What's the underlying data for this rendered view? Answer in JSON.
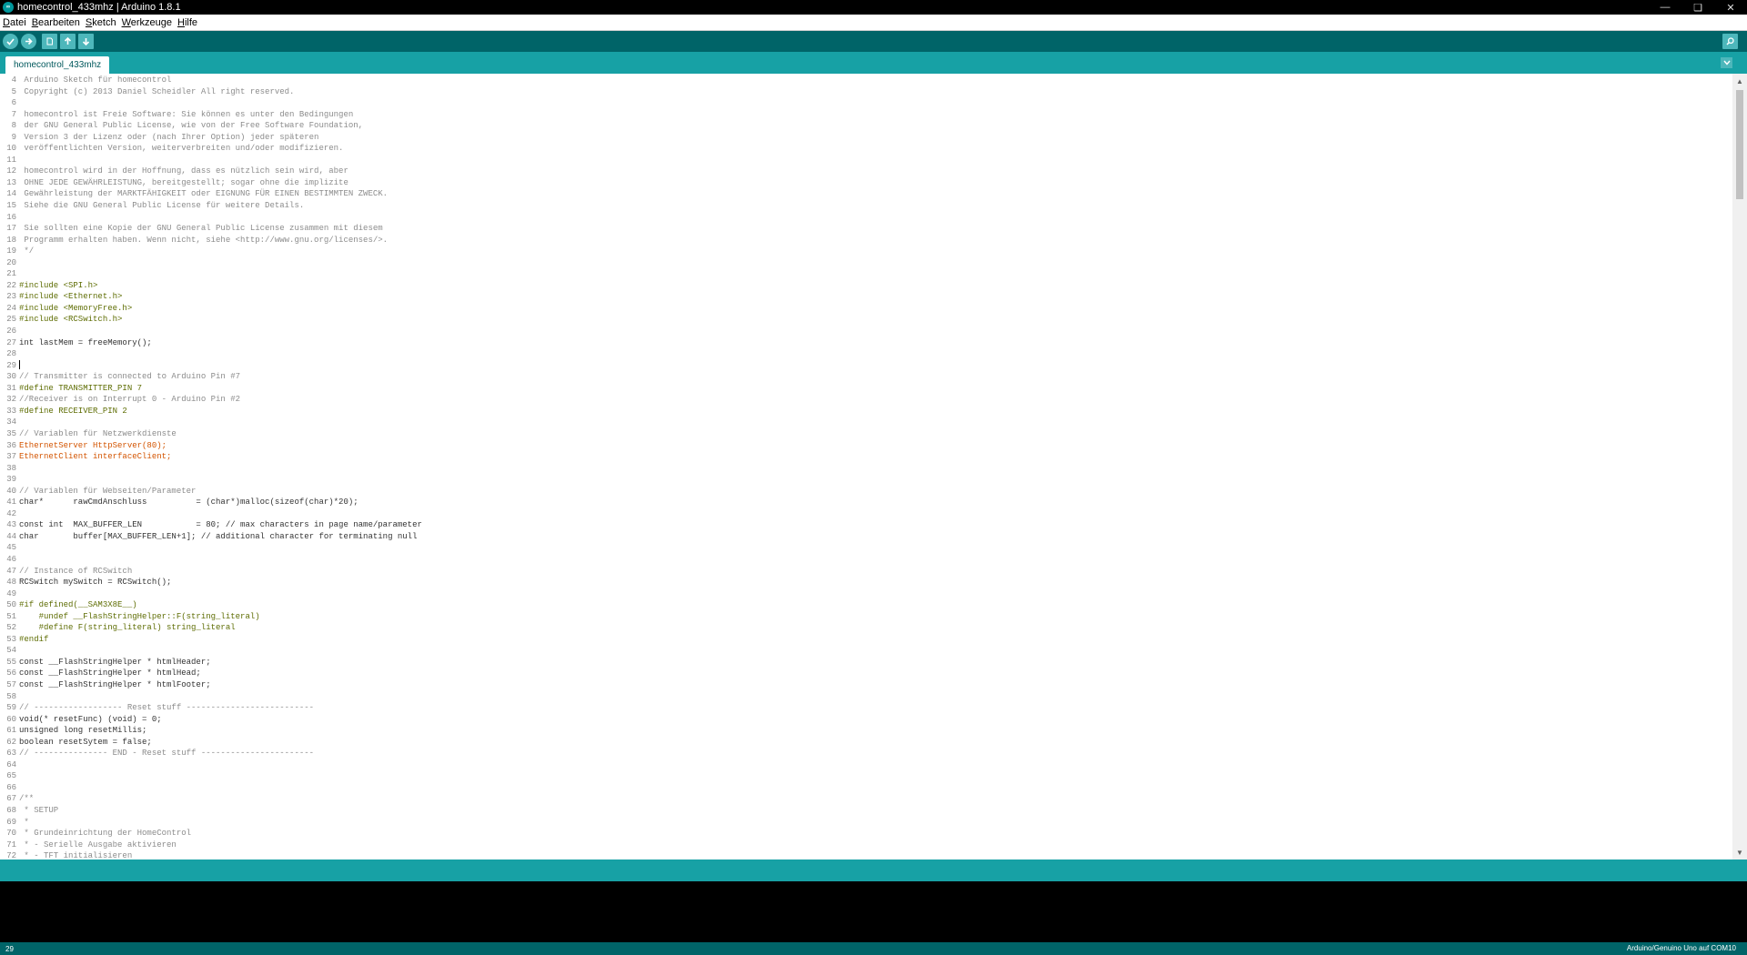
{
  "window": {
    "title": "homecontrol_433mhz | Arduino 1.8.1",
    "controls": [
      "minimize-icon",
      "restore-icon",
      "close-icon"
    ]
  },
  "menu": [
    {
      "label": "Datei",
      "underline": "D",
      "rest": "atei"
    },
    {
      "label": "Bearbeiten",
      "underline": "B",
      "rest": "earbeiten"
    },
    {
      "label": "Sketch",
      "underline": "S",
      "rest": "ketch"
    },
    {
      "label": "Werkzeuge",
      "underline": "W",
      "rest": "erkzeuge"
    },
    {
      "label": "Hilfe",
      "underline": "H",
      "rest": "ilfe"
    }
  ],
  "toolbar": {
    "buttons": [
      "verify",
      "upload",
      "new",
      "open",
      "save"
    ],
    "serial_monitor": "serial-monitor"
  },
  "tabs": [
    {
      "label": "homecontrol_433mhz"
    }
  ],
  "editor": {
    "lines": [
      {
        "n": "4",
        "text": " Arduino Sketch für homecontrol",
        "cls": "comment"
      },
      {
        "n": "5",
        "text": " Copyright (c) 2013 Daniel Scheidler All right reserved.",
        "cls": "comment"
      },
      {
        "n": "6",
        "text": "",
        "cls": "comment"
      },
      {
        "n": "7",
        "text": " homecontrol ist Freie Software: Sie können es unter den Bedingungen",
        "cls": "comment"
      },
      {
        "n": "8",
        "text": " der GNU General Public License, wie von der Free Software Foundation,",
        "cls": "comment"
      },
      {
        "n": "9",
        "text": " Version 3 der Lizenz oder (nach Ihrer Option) jeder späteren",
        "cls": "comment"
      },
      {
        "n": "10",
        "text": " veröffentlichten Version, weiterverbreiten und/oder modifizieren.",
        "cls": "comment"
      },
      {
        "n": "11",
        "text": "",
        "cls": "comment"
      },
      {
        "n": "12",
        "text": " homecontrol wird in der Hoffnung, dass es nützlich sein wird, aber",
        "cls": "comment"
      },
      {
        "n": "13",
        "text": " OHNE JEDE GEWÄHRLEISTUNG, bereitgestellt; sogar ohne die implizite",
        "cls": "comment"
      },
      {
        "n": "14",
        "text": " Gewährleistung der MARKTFÄHIGKEIT oder EIGNUNG FÜR EINEN BESTIMMTEN ZWECK.",
        "cls": "comment"
      },
      {
        "n": "15",
        "text": " Siehe die GNU General Public License für weitere Details.",
        "cls": "comment"
      },
      {
        "n": "16",
        "text": "",
        "cls": "comment"
      },
      {
        "n": "17",
        "text": " Sie sollten eine Kopie der GNU General Public License zusammen mit diesem",
        "cls": "comment"
      },
      {
        "n": "18",
        "text": " Programm erhalten haben. Wenn nicht, siehe <http://www.gnu.org/licenses/>.",
        "cls": "comment"
      },
      {
        "n": "19",
        "text": " */",
        "cls": "comment"
      },
      {
        "n": "20",
        "text": "",
        "cls": ""
      },
      {
        "n": "21",
        "text": "",
        "cls": ""
      },
      {
        "n": "22",
        "text": "#include <SPI.h>",
        "cls": "pp"
      },
      {
        "n": "23",
        "text": "#include <Ethernet.h>",
        "cls": "pp"
      },
      {
        "n": "24",
        "text": "#include <MemoryFree.h>",
        "cls": "pp"
      },
      {
        "n": "25",
        "text": "#include <RCSwitch.h>",
        "cls": "pp"
      },
      {
        "n": "26",
        "text": "",
        "cls": ""
      },
      {
        "n": "27",
        "text": "int lastMem = freeMemory();",
        "cls": ""
      },
      {
        "n": "28",
        "text": "",
        "cls": ""
      },
      {
        "n": "29",
        "text": "",
        "cls": "",
        "caret": true
      },
      {
        "n": "30",
        "text": "// Transmitter is connected to Arduino Pin #7",
        "cls": "comment"
      },
      {
        "n": "31",
        "text": "#define TRANSMITTER_PIN 7",
        "cls": "pp"
      },
      {
        "n": "32",
        "text": "//Receiver is on Interrupt 0 - Arduino Pin #2",
        "cls": "comment"
      },
      {
        "n": "33",
        "text": "#define RECEIVER_PIN 2",
        "cls": "pp"
      },
      {
        "n": "34",
        "text": "",
        "cls": ""
      },
      {
        "n": "35",
        "text": "// Variablen für Netzwerkdienste",
        "cls": "comment"
      },
      {
        "n": "36",
        "text": "EthernetServer HttpServer(80);",
        "cls": "type"
      },
      {
        "n": "37",
        "text": "EthernetClient interfaceClient;",
        "cls": "type"
      },
      {
        "n": "38",
        "text": "",
        "cls": ""
      },
      {
        "n": "39",
        "text": "",
        "cls": ""
      },
      {
        "n": "40",
        "text": "// Variablen für Webseiten/Parameter",
        "cls": "comment"
      },
      {
        "n": "41",
        "text": "char*      rawCmdAnschluss          = (char*)malloc(sizeof(char)*20);",
        "cls": ""
      },
      {
        "n": "42",
        "text": "",
        "cls": ""
      },
      {
        "n": "43",
        "text": "const int  MAX_BUFFER_LEN           = 80; // max characters in page name/parameter",
        "cls": ""
      },
      {
        "n": "44",
        "text": "char       buffer[MAX_BUFFER_LEN+1]; // additional character for terminating null",
        "cls": ""
      },
      {
        "n": "45",
        "text": "",
        "cls": ""
      },
      {
        "n": "46",
        "text": "",
        "cls": ""
      },
      {
        "n": "47",
        "text": "// Instance of RCSwitch",
        "cls": "comment"
      },
      {
        "n": "48",
        "text": "RCSwitch mySwitch = RCSwitch();",
        "cls": ""
      },
      {
        "n": "49",
        "text": "",
        "cls": ""
      },
      {
        "n": "50",
        "text": "#if defined(__SAM3X8E__)",
        "cls": "pp"
      },
      {
        "n": "51",
        "text": "    #undef __FlashStringHelper::F(string_literal)",
        "cls": "pp"
      },
      {
        "n": "52",
        "text": "    #define F(string_literal) string_literal",
        "cls": "pp"
      },
      {
        "n": "53",
        "text": "#endif",
        "cls": "pp"
      },
      {
        "n": "54",
        "text": "",
        "cls": ""
      },
      {
        "n": "55",
        "text": "const __FlashStringHelper * htmlHeader;",
        "cls": ""
      },
      {
        "n": "56",
        "text": "const __FlashStringHelper * htmlHead;",
        "cls": ""
      },
      {
        "n": "57",
        "text": "const __FlashStringHelper * htmlFooter;",
        "cls": ""
      },
      {
        "n": "58",
        "text": "",
        "cls": ""
      },
      {
        "n": "59",
        "text": "// ------------------ Reset stuff --------------------------",
        "cls": "comment"
      },
      {
        "n": "60",
        "text": "void(* resetFunc) (void) = 0;",
        "cls": ""
      },
      {
        "n": "61",
        "text": "unsigned long resetMillis;",
        "cls": ""
      },
      {
        "n": "62",
        "text": "boolean resetSytem = false;",
        "cls": ""
      },
      {
        "n": "63",
        "text": "// --------------- END - Reset stuff -----------------------",
        "cls": "comment"
      },
      {
        "n": "64",
        "text": "",
        "cls": ""
      },
      {
        "n": "65",
        "text": "",
        "cls": ""
      },
      {
        "n": "66",
        "text": "",
        "cls": ""
      },
      {
        "n": "67",
        "text": "/**",
        "cls": "comment"
      },
      {
        "n": "68",
        "text": " * SETUP",
        "cls": "comment"
      },
      {
        "n": "69",
        "text": " *",
        "cls": "comment"
      },
      {
        "n": "70",
        "text": " * Grundeinrichtung der HomeControl",
        "cls": "comment"
      },
      {
        "n": "71",
        "text": " * - Serielle Ausgabe aktivieren",
        "cls": "comment"
      },
      {
        "n": "72",
        "text": " * - TFT initialisieren",
        "cls": "comment"
      }
    ]
  },
  "statusbar": {
    "line_number": "29",
    "board": "Arduino/Genuino Uno auf COM10"
  },
  "colors": {
    "toolbar": "#006468",
    "tabstrip": "#17a1a5",
    "console": "#000000"
  }
}
